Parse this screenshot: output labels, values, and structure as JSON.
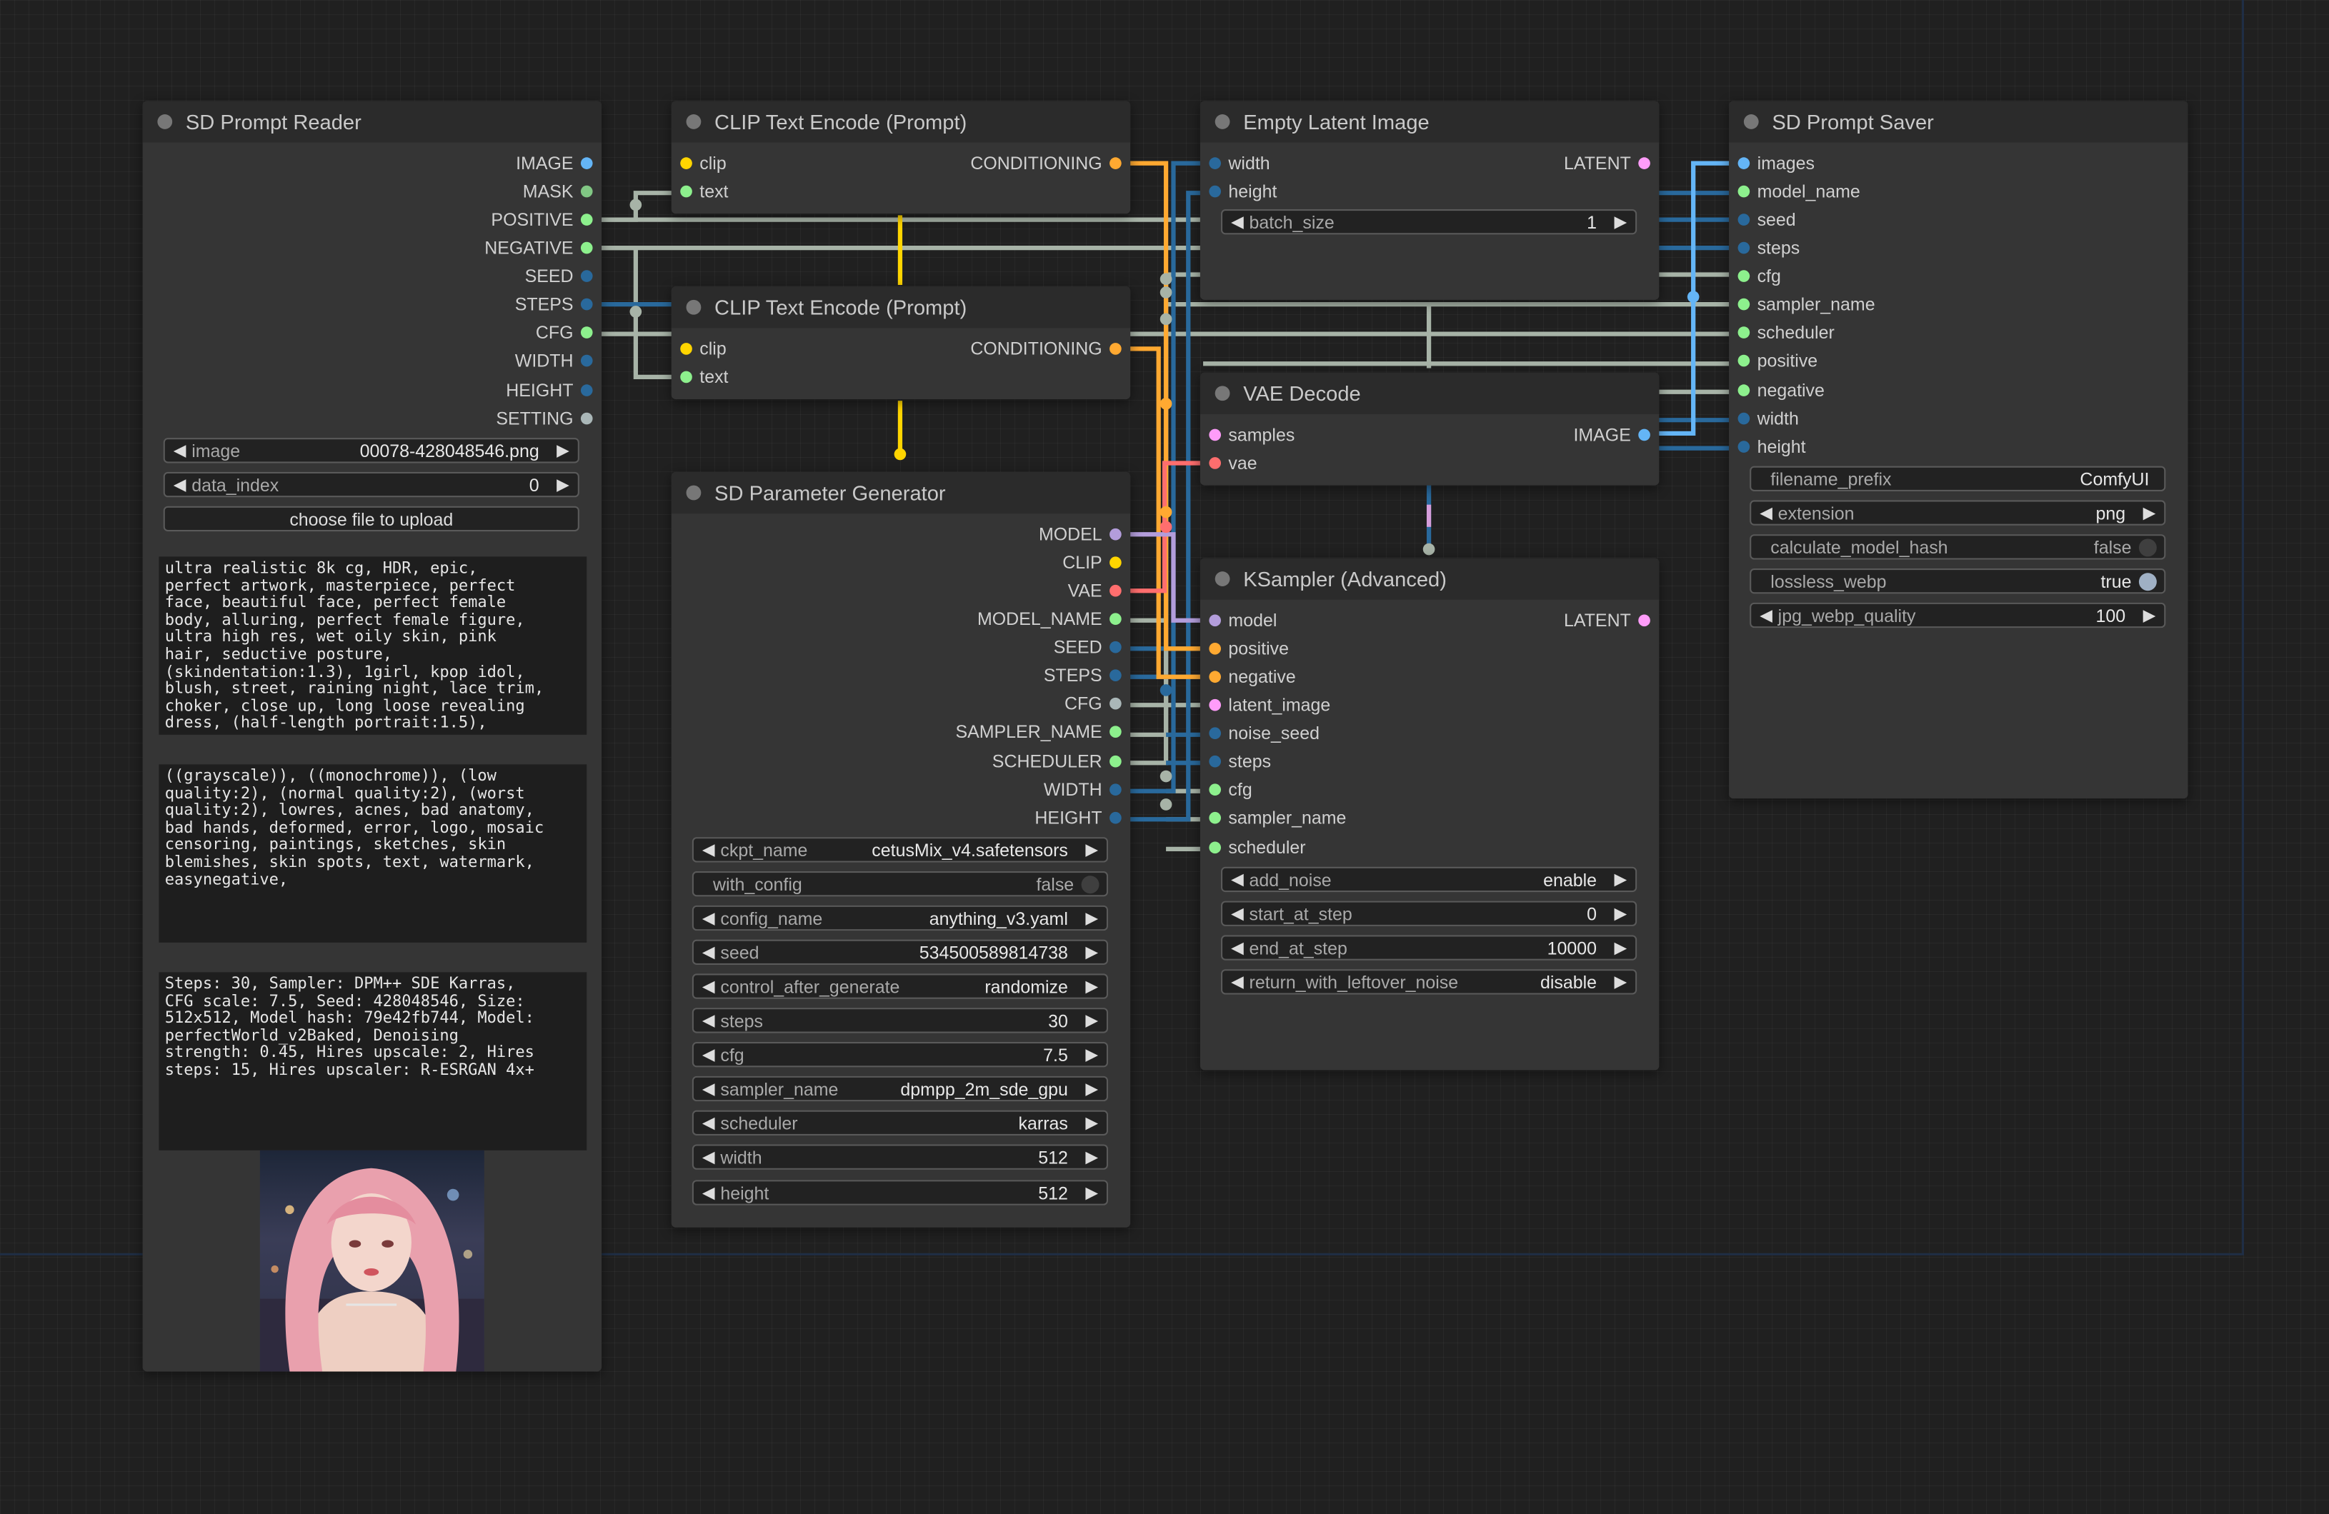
{
  "colors": {
    "canvas_bg": "#202020",
    "node_bg": "#353535",
    "title_bg": "#2b2b2b",
    "slot_image": "#64b5f6",
    "slot_mask": "#81c784",
    "slot_conditioning": "#ffa931",
    "slot_clip": "#ffd500",
    "slot_vae": "#ff6e6e",
    "slot_model": "#b39ddb",
    "slot_latent": "#ff9cf9",
    "slot_int": "#29699c",
    "slot_float": "#aab7b8",
    "slot_string": "#8df08d"
  },
  "nodes": {
    "reader": {
      "title": "SD Prompt Reader",
      "outputs": [
        "IMAGE",
        "MASK",
        "POSITIVE",
        "NEGATIVE",
        "SEED",
        "STEPS",
        "CFG",
        "WIDTH",
        "HEIGHT",
        "SETTING"
      ],
      "widgets": {
        "image_label": "image",
        "image_value": "00078-428048546.png",
        "data_index_label": "data_index",
        "data_index_value": "0",
        "upload_button": "choose file to upload"
      },
      "positive_text": "ultra realistic 8k cg, HDR, epic,\nperfect artwork, masterpiece, perfect\nface, beautiful face, perfect female\nbody, alluring, perfect female figure,\nultra high res, wet oily skin, pink\nhair, seductive posture,\n(skindentation:1.3), 1girl, kpop idol,\nblush, street, raining night, lace trim,\nchoker, close up, long loose revealing\ndress, (half-length portrait:1.5),",
      "negative_text": "((grayscale)), ((monochrome)), (low\nquality:2), (normal quality:2), (worst\nquality:2), lowres, acnes, bad anatomy,\nbad hands, deformed, error, logo, mosaic\ncensoring, paintings, sketches, skin\nblemishes, skin spots, text, watermark,\neasynegative,",
      "settings_text": "Steps: 30, Sampler: DPM++ SDE Karras,\nCFG scale: 7.5, Seed: 428048546, Size:\n512x512, Model hash: 79e42fb744, Model:\nperfectWorld_v2Baked, Denoising\nstrength: 0.45, Hires upscale: 2, Hires\nsteps: 15, Hires upscaler: R-ESRGAN 4x+"
    },
    "clip1": {
      "title": "CLIP Text Encode (Prompt)",
      "inputs": [
        "clip",
        "text"
      ],
      "output": "CONDITIONING"
    },
    "clip2": {
      "title": "CLIP Text Encode (Prompt)",
      "inputs": [
        "clip",
        "text"
      ],
      "output": "CONDITIONING"
    },
    "paramgen": {
      "title": "SD Parameter Generator",
      "outputs": [
        "MODEL",
        "CLIP",
        "VAE",
        "MODEL_NAME",
        "SEED",
        "STEPS",
        "CFG",
        "SAMPLER_NAME",
        "SCHEDULER",
        "WIDTH",
        "HEIGHT"
      ],
      "widgets": [
        {
          "label": "ckpt_name",
          "value": "cetusMix_v4.safetensors"
        },
        {
          "label": "with_config",
          "value": "false"
        },
        {
          "label": "config_name",
          "value": "anything_v3.yaml"
        },
        {
          "label": "seed",
          "value": "534500589814738"
        },
        {
          "label": "control_after_generate",
          "value": "randomize"
        },
        {
          "label": "steps",
          "value": "30"
        },
        {
          "label": "cfg",
          "value": "7.5"
        },
        {
          "label": "sampler_name",
          "value": "dpmpp_2m_sde_gpu"
        },
        {
          "label": "scheduler",
          "value": "karras"
        },
        {
          "label": "width",
          "value": "512"
        },
        {
          "label": "height",
          "value": "512"
        }
      ]
    },
    "latent": {
      "title": "Empty Latent Image",
      "inputs": [
        "width",
        "height"
      ],
      "output": "LATENT",
      "widget": {
        "label": "batch_size",
        "value": "1"
      }
    },
    "vae": {
      "title": "VAE Decode",
      "inputs": [
        "samples",
        "vae"
      ],
      "output": "IMAGE"
    },
    "ksampler": {
      "title": "KSampler (Advanced)",
      "inputs": [
        "model",
        "positive",
        "negative",
        "latent_image",
        "noise_seed",
        "steps",
        "cfg",
        "sampler_name",
        "scheduler"
      ],
      "output": "LATENT",
      "widgets": [
        {
          "label": "add_noise",
          "value": "enable"
        },
        {
          "label": "start_at_step",
          "value": "0"
        },
        {
          "label": "end_at_step",
          "value": "10000"
        },
        {
          "label": "return_with_leftover_noise",
          "value": "disable"
        }
      ]
    },
    "saver": {
      "title": "SD Prompt Saver",
      "inputs": [
        "images",
        "model_name",
        "seed",
        "steps",
        "cfg",
        "sampler_name",
        "scheduler",
        "positive",
        "negative",
        "width",
        "height"
      ],
      "widgets": [
        {
          "label": "filename_prefix",
          "value": "ComfyUI"
        },
        {
          "label": "extension",
          "value": "png"
        },
        {
          "label": "calculate_model_hash",
          "value": "false"
        },
        {
          "label": "lossless_webp",
          "value": "true"
        },
        {
          "label": "jpg_webp_quality",
          "value": "100"
        }
      ]
    }
  }
}
